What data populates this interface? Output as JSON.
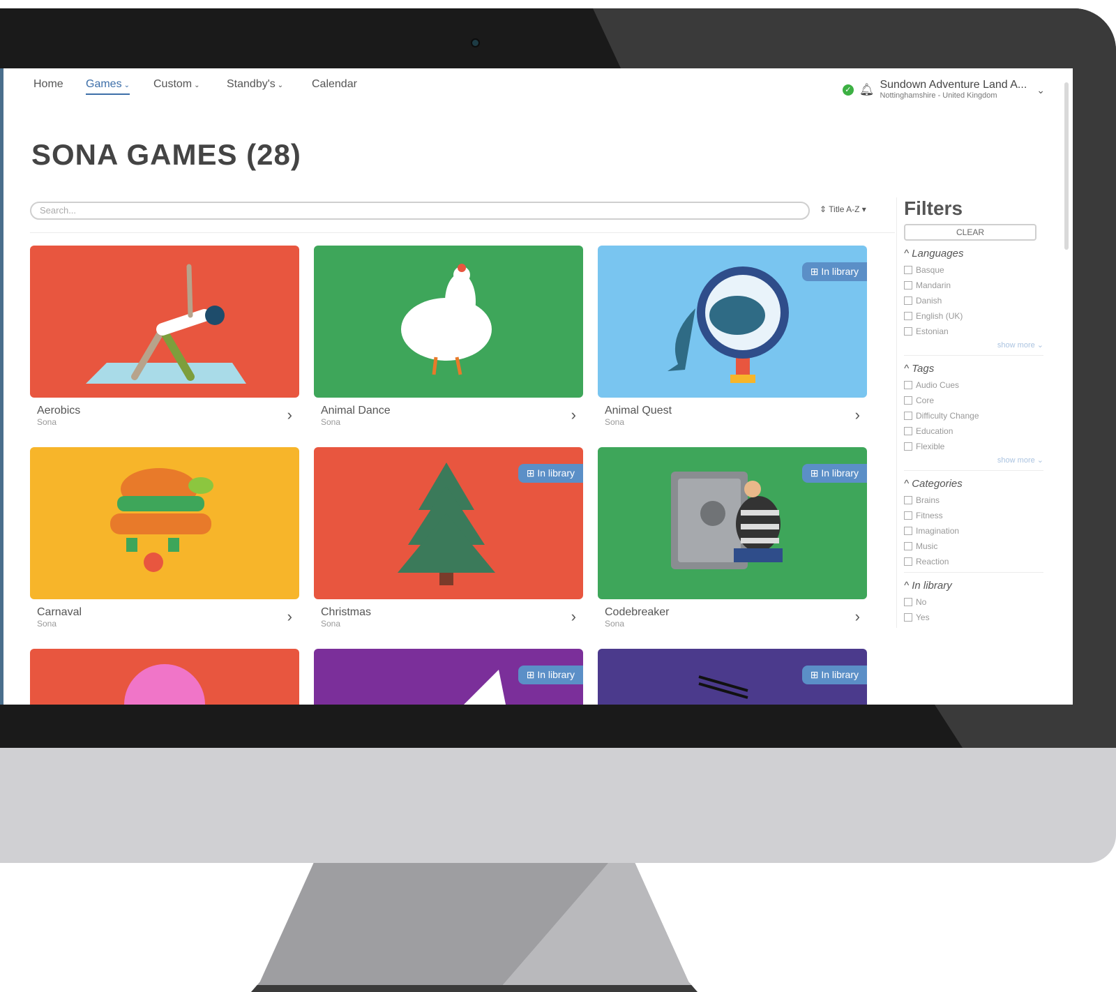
{
  "nav": {
    "items": [
      {
        "label": "Home"
      },
      {
        "label": "Games",
        "active": true
      },
      {
        "label": "Custom"
      },
      {
        "label": "Standby's"
      },
      {
        "label": "Calendar"
      }
    ],
    "caret": "⌄"
  },
  "account": {
    "name": "Sundown Adventure Land A...",
    "location": "Nottinghamshire - United Kingdom"
  },
  "page": {
    "title": "SONA GAMES (28)"
  },
  "search": {
    "placeholder": "Search..."
  },
  "sort": {
    "label": "Title A-Z"
  },
  "games": [
    {
      "title": "Aerobics",
      "provider": "Sona",
      "color": "#e8563f",
      "in_library": false
    },
    {
      "title": "Animal Dance",
      "provider": "Sona",
      "color": "#3ea65a",
      "in_library": false
    },
    {
      "title": "Animal Quest",
      "provider": "Sona",
      "color": "#79c5f0",
      "in_library": true
    },
    {
      "title": "Carnaval",
      "provider": "Sona",
      "color": "#f7b52a",
      "in_library": false
    },
    {
      "title": "Christmas",
      "provider": "Sona",
      "color": "#e8563f",
      "in_library": true
    },
    {
      "title": "Codebreaker",
      "provider": "Sona",
      "color": "#3ea65a",
      "in_library": true
    },
    {
      "title": "",
      "provider": "",
      "color": "#e8563f",
      "in_library": false
    },
    {
      "title": "",
      "provider": "",
      "color": "#7b2f9a",
      "in_library": true
    },
    {
      "title": "",
      "provider": "",
      "color": "#4b3a8c",
      "in_library": true
    }
  ],
  "badge_label": "In library",
  "filters": {
    "title": "Filters",
    "clear_label": "CLEAR",
    "show_more": "show more",
    "groups": [
      {
        "title": "Languages",
        "items": [
          "Basque",
          "Mandarin",
          "Danish",
          "English (UK)",
          "Estonian"
        ],
        "show_more": true
      },
      {
        "title": "Tags",
        "items": [
          "Audio Cues",
          "Core",
          "Difficulty Change",
          "Education",
          "Flexible"
        ],
        "show_more": true
      },
      {
        "title": "Categories",
        "items": [
          "Brains",
          "Fitness",
          "Imagination",
          "Music",
          "Reaction"
        ],
        "show_more": false
      },
      {
        "title": "In library",
        "items": [
          "No",
          "Yes"
        ],
        "show_more": false
      }
    ]
  }
}
